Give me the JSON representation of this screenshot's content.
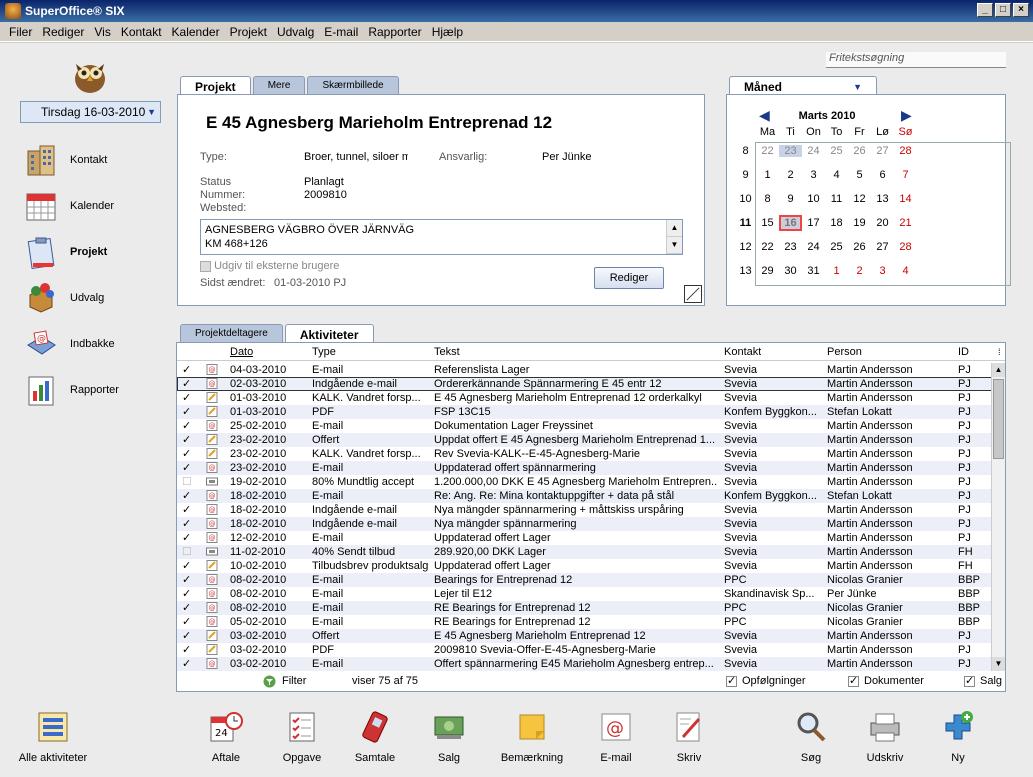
{
  "window": {
    "title": "SuperOffice® SIX"
  },
  "menu": [
    "Filer",
    "Rediger",
    "Vis",
    "Kontakt",
    "Kalender",
    "Projekt",
    "Udvalg",
    "E-mail",
    "Rapporter",
    "Hjælp"
  ],
  "search": {
    "placeholder": "Fritekstsøgning"
  },
  "date_selector": "Tirsdag 16-03-2010",
  "nav": [
    {
      "label": "Kontakt",
      "icon": "building-icon"
    },
    {
      "label": "Kalender",
      "icon": "calendar-icon"
    },
    {
      "label": "Projekt",
      "icon": "clipboard-icon",
      "active": true
    },
    {
      "label": "Udvalg",
      "icon": "selection-icon"
    },
    {
      "label": "Indbakke",
      "icon": "inbox-icon"
    },
    {
      "label": "Rapporter",
      "icon": "reports-icon"
    }
  ],
  "project": {
    "tabs": [
      "Projekt",
      "Mere",
      "Skærmbillede"
    ],
    "title": "E 45 Agnesberg Marieholm Entreprenad 12",
    "type_label": "Type:",
    "type_value": "Broer, tunnel, siloer m",
    "responsible_label": "Ansvarlig:",
    "responsible_value": "Per Jünke",
    "status_label": "Status",
    "status_value": "Planlagt",
    "number_label": "Nummer:",
    "number_value": "2009810",
    "website_label": "Websted:",
    "description_line1": "AGNESBERG VÄGBRO ÖVER JÄRNVÄG",
    "description_line2": "KM 468+126",
    "publish_label": "Udgiv til eksterne brugere",
    "last_changed_label": "Sidst ændret:",
    "last_changed_value": "01-03-2010 PJ",
    "edit_button": "Rediger"
  },
  "calendar": {
    "tab": "Måned",
    "month_title": "Marts 2010",
    "weekdays": [
      "Ma",
      "Ti",
      "On",
      "To",
      "Fr",
      "Lø",
      "Sø"
    ],
    "weeks": [
      {
        "wk": "8",
        "days": [
          "22",
          "23",
          "24",
          "25",
          "26",
          "27",
          "28"
        ]
      },
      {
        "wk": "9",
        "days": [
          "1",
          "2",
          "3",
          "4",
          "5",
          "6",
          "7"
        ]
      },
      {
        "wk": "10",
        "days": [
          "8",
          "9",
          "10",
          "11",
          "12",
          "13",
          "14"
        ]
      },
      {
        "wk": "11",
        "days": [
          "15",
          "16",
          "17",
          "18",
          "19",
          "20",
          "21"
        ]
      },
      {
        "wk": "12",
        "days": [
          "22",
          "23",
          "24",
          "25",
          "26",
          "27",
          "28"
        ]
      },
      {
        "wk": "13",
        "days": [
          "29",
          "30",
          "31",
          "1",
          "2",
          "3",
          "4"
        ]
      }
    ],
    "today": "16"
  },
  "activities": {
    "tabs": [
      "Projektdeltagere",
      "Aktiviteter"
    ],
    "columns": {
      "date": "Dato",
      "type": "Type",
      "text": "Tekst",
      "contact": "Kontakt",
      "person": "Person",
      "id": "ID"
    },
    "rows": [
      {
        "done": true,
        "icon": "email",
        "date": "04-03-2010",
        "type": "E-mail",
        "text": "Referenslista Lager",
        "contact": "Svevia",
        "person": "Martin Andersson",
        "id": "PJ"
      },
      {
        "done": true,
        "icon": "email",
        "date": "02-03-2010",
        "type": "Indgående e-mail",
        "text": "Ordererkännande Spännarmering  E 45 entr 12",
        "contact": "Svevia",
        "person": "Martin Andersson",
        "id": "PJ",
        "selected": true
      },
      {
        "done": true,
        "icon": "doc",
        "date": "01-03-2010",
        "type": "KALK. Vandret forsp...",
        "text": "E 45 Agnesberg Marieholm Entreprenad 12 orderkalkyl",
        "contact": "Svevia",
        "person": "Martin Andersson",
        "id": "PJ"
      },
      {
        "done": true,
        "icon": "doc",
        "date": "01-03-2010",
        "type": "PDF",
        "text": "FSP 13C15",
        "contact": "Konfem Byggkon...",
        "person": "Stefan Lokatt",
        "id": "PJ"
      },
      {
        "done": true,
        "icon": "email",
        "date": "25-02-2010",
        "type": "E-mail",
        "text": "Dokumentation Lager Freyssinet",
        "contact": "Svevia",
        "person": "Martin Andersson",
        "id": "PJ"
      },
      {
        "done": true,
        "icon": "doc",
        "date": "23-02-2010",
        "type": "Offert",
        "text": "Uppdat offert E 45 Agnesberg Marieholm Entreprenad 1...",
        "contact": "Svevia",
        "person": "Martin Andersson",
        "id": "PJ"
      },
      {
        "done": true,
        "icon": "doc",
        "date": "23-02-2010",
        "type": "KALK. Vandret forsp...",
        "text": "Rev Svevia-KALK--E-45-Agnesberg-Marie",
        "contact": "Svevia",
        "person": "Martin Andersson",
        "id": "PJ"
      },
      {
        "done": true,
        "icon": "email",
        "date": "23-02-2010",
        "type": "E-mail",
        "text": "Uppdaterad offert spännarmering",
        "contact": "Svevia",
        "person": "Martin Andersson",
        "id": "PJ"
      },
      {
        "done": false,
        "icon": "sale",
        "date": "19-02-2010",
        "type": "80% Mundtlig accept",
        "text": "1.200.000,00 DKK E 45 Agnesberg Marieholm Entrepren...",
        "contact": "Svevia",
        "person": "Martin Andersson",
        "id": "PJ"
      },
      {
        "done": true,
        "icon": "email",
        "date": "18-02-2010",
        "type": "E-mail",
        "text": "Re: Ang. Re: Mina kontaktuppgifter + data på stål",
        "contact": "Konfem Byggkon...",
        "person": "Stefan Lokatt",
        "id": "PJ"
      },
      {
        "done": true,
        "icon": "email",
        "date": "18-02-2010",
        "type": "Indgående e-mail",
        "text": "Nya mängder spännarmering + måttskiss urspåring",
        "contact": "Svevia",
        "person": "Martin Andersson",
        "id": "PJ"
      },
      {
        "done": true,
        "icon": "email",
        "date": "18-02-2010",
        "type": "Indgående e-mail",
        "text": "Nya mängder spännarmering",
        "contact": "Svevia",
        "person": "Martin Andersson",
        "id": "PJ"
      },
      {
        "done": true,
        "icon": "email",
        "date": "12-02-2010",
        "type": "E-mail",
        "text": "Uppdaterad offert Lager",
        "contact": "Svevia",
        "person": "Martin Andersson",
        "id": "PJ"
      },
      {
        "done": false,
        "icon": "sale",
        "date": "11-02-2010",
        "type": "40% Sendt tilbud",
        "text": "289.920,00 DKK Lager",
        "contact": "Svevia",
        "person": "Martin Andersson",
        "id": "FH"
      },
      {
        "done": true,
        "icon": "doc",
        "date": "10-02-2010",
        "type": "Tilbudsbrev produktsalg",
        "text": "Uppdaterad offert Lager",
        "contact": "Svevia",
        "person": "Martin Andersson",
        "id": "FH"
      },
      {
        "done": true,
        "icon": "email",
        "date": "08-02-2010",
        "type": "E-mail",
        "text": "Bearings for Entreprenad 12",
        "contact": "PPC",
        "person": "Nicolas Granier",
        "id": "BBP"
      },
      {
        "done": true,
        "icon": "email",
        "date": "08-02-2010",
        "type": "E-mail",
        "text": "Lejer til E12",
        "contact": "Skandinavisk Sp...",
        "person": "Per Jünke",
        "id": "BBP"
      },
      {
        "done": true,
        "icon": "email",
        "date": "08-02-2010",
        "type": "E-mail",
        "text": "RE Bearings for Entreprenad 12",
        "contact": "PPC",
        "person": "Nicolas Granier",
        "id": "BBP"
      },
      {
        "done": true,
        "icon": "email",
        "date": "05-02-2010",
        "type": "E-mail",
        "text": "RE Bearings for Entreprenad 12",
        "contact": "PPC",
        "person": "Nicolas Granier",
        "id": "BBP"
      },
      {
        "done": true,
        "icon": "doc",
        "date": "03-02-2010",
        "type": "Offert",
        "text": "E 45 Agnesberg Marieholm Entreprenad 12",
        "contact": "Svevia",
        "person": "Martin Andersson",
        "id": "PJ"
      },
      {
        "done": true,
        "icon": "doc",
        "date": "03-02-2010",
        "type": "PDF",
        "text": "2009810 Svevia-Offer-E-45-Agnesberg-Marie",
        "contact": "Svevia",
        "person": "Martin Andersson",
        "id": "PJ"
      },
      {
        "done": true,
        "icon": "email",
        "date": "03-02-2010",
        "type": "E-mail",
        "text": "Offert spännarmering E45 Marieholm Agnesberg  entrep...",
        "contact": "Svevia",
        "person": "Martin Andersson",
        "id": "PJ"
      }
    ],
    "filter_label": "Filter",
    "count_label": "viser 75 af 75",
    "footer_checks": [
      {
        "label": "Opfølgninger",
        "checked": true
      },
      {
        "label": "Dokumenter",
        "checked": true
      },
      {
        "label": "Salg",
        "checked": true
      }
    ]
  },
  "toolbar": [
    {
      "label": "Alle aktiviteter",
      "icon": "all-activities-icon"
    },
    {
      "label": "Aftale",
      "icon": "appointment-icon"
    },
    {
      "label": "Opgave",
      "icon": "task-icon"
    },
    {
      "label": "Samtale",
      "icon": "phone-icon"
    },
    {
      "label": "Salg",
      "icon": "sale-icon"
    },
    {
      "label": "Bemærkning",
      "icon": "note-icon"
    },
    {
      "label": "E-mail",
      "icon": "email-icon"
    },
    {
      "label": "Skriv",
      "icon": "write-icon"
    },
    {
      "label": "Søg",
      "icon": "search-icon"
    },
    {
      "label": "Udskriv",
      "icon": "print-icon"
    },
    {
      "label": "Ny",
      "icon": "new-icon"
    }
  ]
}
